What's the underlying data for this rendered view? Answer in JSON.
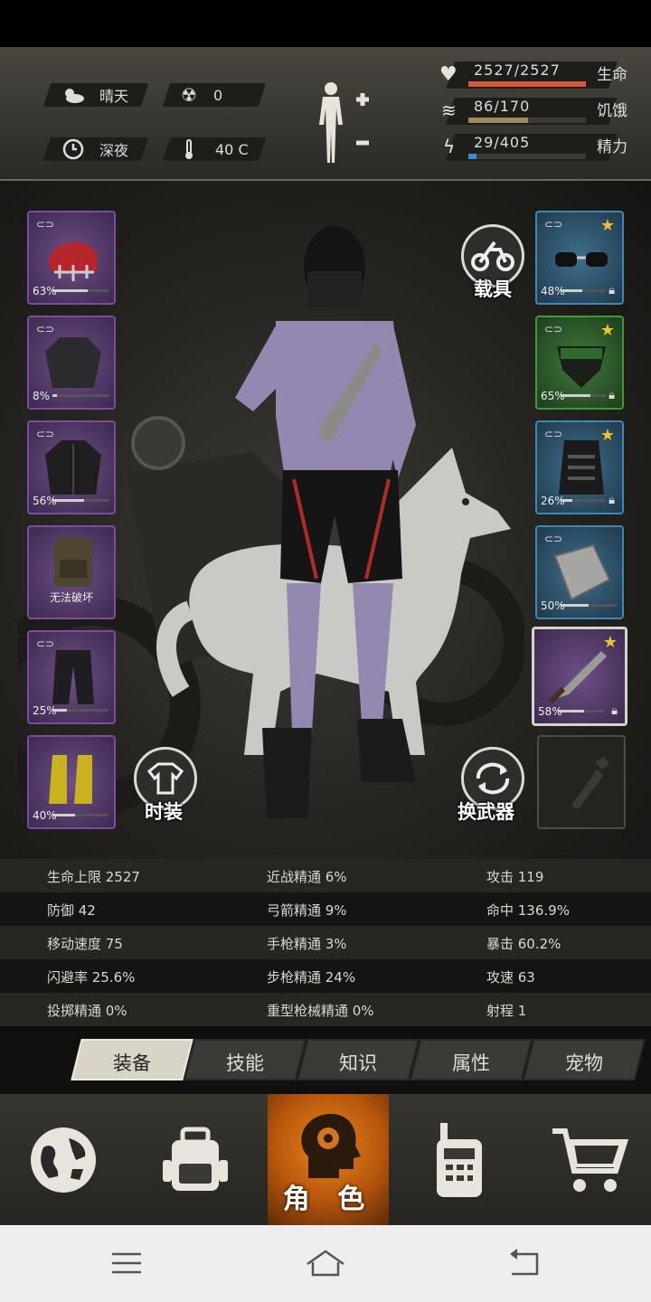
{
  "status": {
    "weather": "晴天",
    "radiation": "0",
    "time_of_day": "深夜",
    "temperature": "40 C"
  },
  "vitals": {
    "health": {
      "label": "生命",
      "value": "2527/2527",
      "ratio": 1.0,
      "color": "#d9573b"
    },
    "hunger": {
      "label": "饥饿",
      "value": "86/170",
      "ratio": 0.506,
      "color": "#9c8a5e"
    },
    "energy": {
      "label": "精力",
      "value": "29/405",
      "ratio": 0.072,
      "color": "#3a8fd4"
    }
  },
  "equipment": {
    "left": [
      {
        "name": "helmet",
        "durability": "63%",
        "level": 0.63
      },
      {
        "name": "shirt",
        "durability": "8%",
        "level": 0.08
      },
      {
        "name": "jacket",
        "durability": "56%",
        "level": 0.56
      },
      {
        "name": "backpack",
        "label": "无法破坏"
      },
      {
        "name": "pants",
        "durability": "25%",
        "level": 0.25
      },
      {
        "name": "boots",
        "durability": "40%",
        "level": 0.4
      }
    ],
    "right": [
      {
        "name": "glasses",
        "durability": "48%",
        "level": 0.48
      },
      {
        "name": "mask",
        "durability": "65%",
        "level": 0.65
      },
      {
        "name": "vest",
        "durability": "26%",
        "level": 0.26
      },
      {
        "name": "shield",
        "durability": "50%",
        "level": 0.5
      },
      {
        "name": "machete",
        "durability": "58%",
        "level": 0.58
      }
    ]
  },
  "buttons": {
    "vehicle": "载具",
    "fashion": "时装",
    "switch_weapon": "换武器"
  },
  "stats": [
    [
      "生命上限 2527",
      "近战精通 6%",
      "攻击 119"
    ],
    [
      "防御 42",
      "弓箭精通 9%",
      "命中 136.9%"
    ],
    [
      "移动速度 75",
      "手枪精通 3%",
      "暴击 60.2%"
    ],
    [
      "闪避率 25.6%",
      "步枪精通 24%",
      "攻速 63"
    ],
    [
      "投掷精通 0%",
      "重型枪械精通 0%",
      "射程 1"
    ]
  ],
  "tabs": [
    "装备",
    "技能",
    "知识",
    "属性",
    "宠物"
  ],
  "active_tab": "装备",
  "nav": {
    "role_label": "角 色"
  },
  "colors": {
    "rare_purple": "#7d4aa5",
    "rare_blue": "#3d88b4",
    "rare_green": "#3c9a3a",
    "accent_orange": "#e8851c"
  }
}
